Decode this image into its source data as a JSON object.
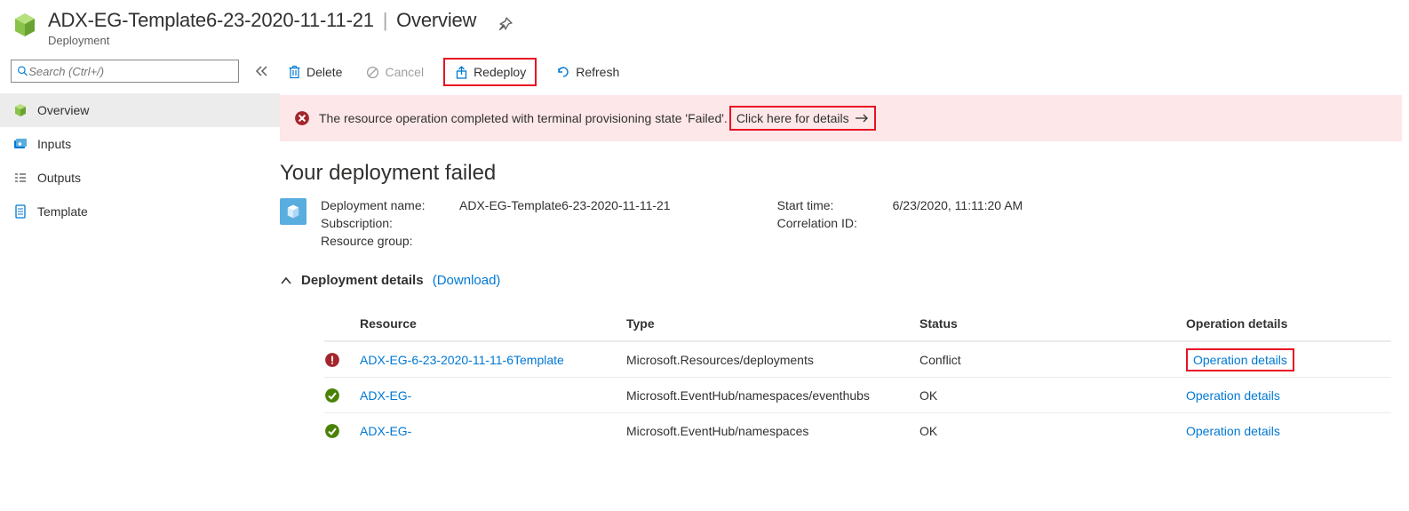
{
  "header": {
    "title_main": "ADX-EG-Template6-23-2020-11-11-21",
    "title_suffix": "Overview",
    "subtitle": "Deployment"
  },
  "search": {
    "placeholder": "Search (Ctrl+/)"
  },
  "sidebar": {
    "items": [
      {
        "label": "Overview"
      },
      {
        "label": "Inputs"
      },
      {
        "label": "Outputs"
      },
      {
        "label": "Template"
      }
    ]
  },
  "toolbar": {
    "delete": "Delete",
    "cancel": "Cancel",
    "redeploy": "Redeploy",
    "refresh": "Refresh"
  },
  "banner": {
    "message": "The resource operation completed with terminal provisioning state 'Failed'.",
    "details_link": "Click here for details"
  },
  "main_heading": "Your deployment failed",
  "meta": {
    "left": {
      "deployment_name_label": "Deployment name:",
      "deployment_name_value": "ADX-EG-Template6-23-2020-11-11-21",
      "subscription_label": "Subscription:",
      "subscription_value": "",
      "resource_group_label": "Resource group:",
      "resource_group_value": ""
    },
    "right": {
      "start_time_label": "Start time:",
      "start_time_value": "6/23/2020, 11:11:20 AM",
      "correlation_label": "Correlation ID:",
      "correlation_value": ""
    }
  },
  "details_section": {
    "label": "Deployment details",
    "download": "(Download)"
  },
  "table": {
    "headers": {
      "resource": "Resource",
      "type": "Type",
      "status": "Status",
      "opdetails": "Operation details"
    },
    "rows": [
      {
        "status_kind": "error",
        "resource": "ADX-EG-6-23-2020-11-11-6Template",
        "type": "Microsoft.Resources/deployments",
        "status": "Conflict",
        "op": "Operation details",
        "highlight": true
      },
      {
        "status_kind": "ok",
        "resource": "ADX-EG-",
        "type": "Microsoft.EventHub/namespaces/eventhubs",
        "status": "OK",
        "op": "Operation details",
        "highlight": false
      },
      {
        "status_kind": "ok",
        "resource": "ADX-EG-",
        "type": "Microsoft.EventHub/namespaces",
        "status": "OK",
        "op": "Operation details",
        "highlight": false
      }
    ]
  }
}
